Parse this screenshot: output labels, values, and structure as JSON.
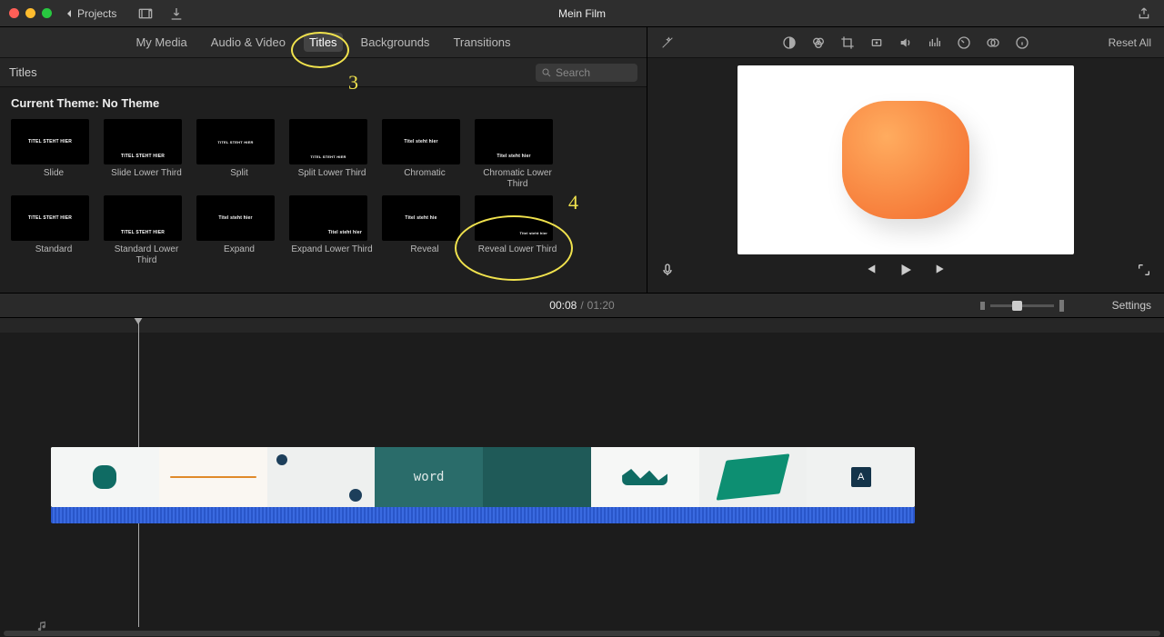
{
  "window": {
    "back_label": "Projects",
    "title": "Mein Film"
  },
  "tabs": {
    "my_media": "My Media",
    "audio_video": "Audio & Video",
    "titles": "Titles",
    "backgrounds": "Backgrounds",
    "transitions": "Transitions"
  },
  "titles_panel": {
    "header": "Titles",
    "search_placeholder": "Search",
    "theme_label": "Current Theme: No Theme",
    "items": [
      {
        "label": "Slide",
        "inner": "TITEL STEHT HIER",
        "cls": ""
      },
      {
        "label": "Slide Lower Third",
        "inner": "TITEL STEHT HIER",
        "cls": "lower"
      },
      {
        "label": "Split",
        "inner": "TITEL STEHT HIER",
        "cls": "tiny"
      },
      {
        "label": "Split Lower Third",
        "inner": "TITEL STEHT HIER",
        "cls": "lower tiny"
      },
      {
        "label": "Chromatic",
        "inner": "Titel steht hier",
        "cls": ""
      },
      {
        "label": "Chromatic Lower Third",
        "inner": "Titel steht hier",
        "cls": "lower"
      },
      {
        "label": "Standard",
        "inner": "TITEL STEHT HIER",
        "cls": ""
      },
      {
        "label": "Standard Lower Third",
        "inner": "TITEL STEHT HIER",
        "cls": "lower"
      },
      {
        "label": "Expand",
        "inner": "Titel steht hier",
        "cls": ""
      },
      {
        "label": "Expand Lower Third",
        "inner": "Titel steht hier",
        "cls": "lowerR"
      },
      {
        "label": "Reveal",
        "inner": "Titel steht hie",
        "cls": ""
      },
      {
        "label": "Reveal Lower Third",
        "inner": "Titel steht hier",
        "cls": "lowerR tiny"
      }
    ]
  },
  "preview": {
    "reset_label": "Reset All"
  },
  "time": {
    "current": "00:08",
    "sep": "/",
    "total": "01:20",
    "settings_label": "Settings"
  },
  "annotations": {
    "n1": "3",
    "n2": "4"
  },
  "clip": {
    "word": "word"
  }
}
